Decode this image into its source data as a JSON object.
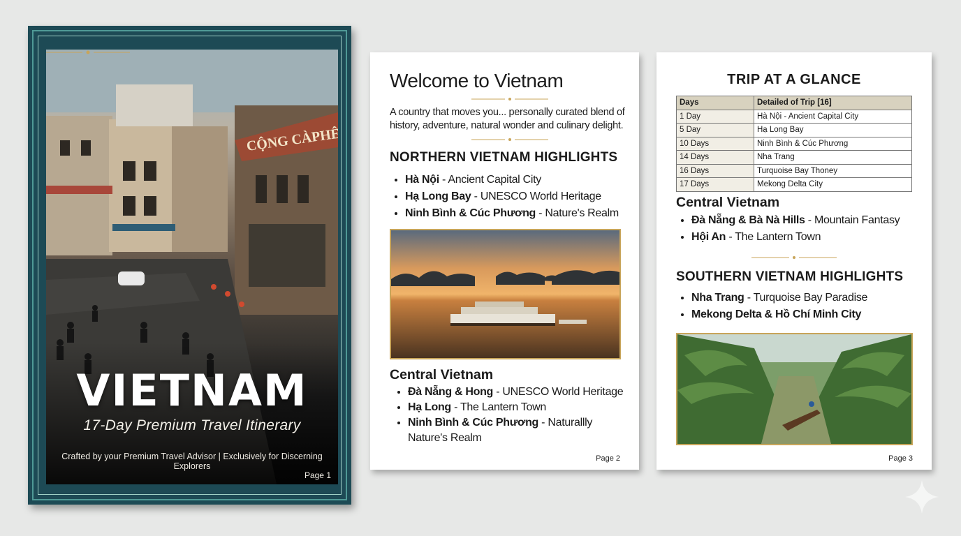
{
  "page1": {
    "sign_text": "CỘNG CÀPHÊ",
    "title": "VIETNAM",
    "subtitle": "17-Day Premium Travel Itinerary",
    "credit": "Crafted by your Premium Travel Advisor | Exclusively for Discerning Explorers",
    "page_label": "Page 1"
  },
  "page2": {
    "title": "Welcome to Vietnam",
    "intro": "A country that moves you... personally curated blend of history, adventure, natural wonder and culinary delight.",
    "northern_heading": "NORTHERN VIETNAM HIGHLIGHTS",
    "northern_items": [
      {
        "name": "Hà Nội",
        "desc": "- Ancient Capital City"
      },
      {
        "name": "Hạ Long Bay",
        "desc": "- UNESCO World Heritage"
      },
      {
        "name": "Ninh Bình & Cúc Phương",
        "desc": "- Nature's Realm"
      }
    ],
    "central_heading": "Central Vietnam",
    "central_items": [
      {
        "name": "Đà Nẵng & Hong",
        "desc": "- UNESCO World Heritage"
      },
      {
        "name": "Hạ Long",
        "desc": "- The Lantern Town"
      },
      {
        "name": "Ninh Bình & Cúc Phương",
        "desc": "- Naturallly Nature's Realm"
      }
    ],
    "page_label": "Page 2"
  },
  "page3": {
    "title": "TRIP AT A GLANCE",
    "table_headers": [
      "Days",
      "Detailed of Trip [16]"
    ],
    "table_rows": [
      [
        "1 Day",
        "Hà Nội - Ancient Capital City"
      ],
      [
        "5 Day",
        "Hạ Long Bay"
      ],
      [
        "10 Days",
        "Ninh Bình & Cúc Phương"
      ],
      [
        "14 Days",
        "Nha Trang"
      ],
      [
        "16 Days",
        "Turquoise Bay Thoney"
      ],
      [
        "17 Days",
        "Mekong Delta City"
      ]
    ],
    "central_heading": "Central Vietnam",
    "central_items": [
      {
        "name": "Đà Nẵng & Bà Nà Hills",
        "desc": "- Mountain Fantasy"
      },
      {
        "name": "Hội An",
        "desc": "- The Lantern Town"
      }
    ],
    "southern_heading": "SOUTHERN VIETNAM HIGHLIGHTS",
    "southern_items": [
      {
        "name": "Nha Trang",
        "desc": "- Turquoise Bay Paradise"
      },
      {
        "name": "Mekong Delta & Hồ Chí Minh City",
        "desc": ""
      }
    ],
    "page_label": "Page 3"
  },
  "colors": {
    "cover_frame": "#1d4a55",
    "gold_accent": "#c8a55a",
    "table_header": "#d8d2bf"
  }
}
